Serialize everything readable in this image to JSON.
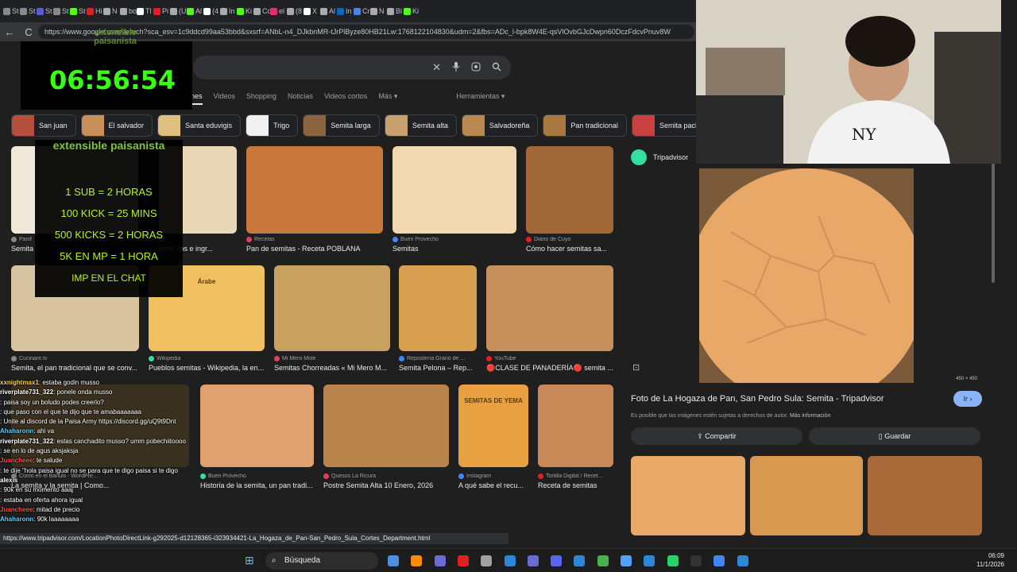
{
  "browser": {
    "tabs": [
      "St",
      "St",
      "St",
      "St",
      "St",
      "Hi",
      "N",
      "bo",
      "Tl",
      "Pi",
      "(U",
      "Al",
      "(4",
      "In",
      "Ki",
      "Cd",
      "el",
      "(8",
      "X",
      "Al",
      "In",
      "Cr",
      "N",
      "Bl",
      "Ki"
    ],
    "url": "https://www.google.com/search?sca_esv=1c9ddcd99aa53bbd&sxsrf=ANbL-n4_DJkbnMR-tJrPlByze80HB21Lw:1768122104830&udm=2&fbs=ADc_l-bpk8W4E-qsVlOvbGJcDwpn60DczFdcvPnuv8W",
    "back": "←",
    "reload": "C"
  },
  "timer": {
    "logo": "extensible paisanista",
    "time": "06:56:54"
  },
  "search": {
    "clear": "✕",
    "mic": "mic",
    "lens": "lens",
    "go": "⌕"
  },
  "filters": [
    "nes",
    "Videos",
    "Shopping",
    "Noticias",
    "Videos cortos",
    "Más ▾",
    "Herramientas ▾"
  ],
  "chips": [
    {
      "label": "San juan",
      "color": "#b4503c"
    },
    {
      "label": "El salvador",
      "color": "#c89058"
    },
    {
      "label": "Santa eduvigis",
      "color": "#e0c080"
    },
    {
      "label": "Trigo",
      "color": "#f0f0f0"
    },
    {
      "label": "Semita larga",
      "color": "#8c6440"
    },
    {
      "label": "Semita alta",
      "color": "#c8a070"
    },
    {
      "label": "Salvadoreña",
      "color": "#b88850"
    },
    {
      "label": "Pan tradicional",
      "color": "#a87840"
    },
    {
      "label": "Semita pacha",
      "color": "#c84040"
    }
  ],
  "results": {
    "row1": [
      {
        "src": "Panif",
        "cap": "Semita",
        "color": "#f0e8d8"
      },
      {
        "src": "",
        "cap": "ecta: tips e ingr...",
        "color": "#e8d8b8"
      },
      {
        "src": "Recetas",
        "cap": "Pan de semitas - Receta POBLANA",
        "color": "#c8783a"
      },
      {
        "src": "Buen Provecho",
        "cap": "Semitas",
        "color": "#f0d8b0"
      },
      {
        "src": "Diario de Cuyo",
        "cap": "Cómo hacer semitas sa...",
        "color": "#a06838"
      }
    ],
    "row2": [
      {
        "src": "Cucinare.tv",
        "cap": "Semita, el pan tradicional que se conv...",
        "color": "#d8c4a0"
      },
      {
        "src": "Wikipedia",
        "cap": "Pueblos semitas - Wikipedia, la en...",
        "color": "#f0c060",
        "extra": "Árabe"
      },
      {
        "src": "Mi Mero Mole",
        "cap": "Semitas Chorreadas « Mi Mero M...",
        "color": "#c8a060"
      },
      {
        "src": "Repostería Grano de ...",
        "cap": "Semita Pelona – Rep...",
        "color": "#d8a050"
      },
      {
        "src": "YouTube",
        "cap": "🔴CLASE DE PANADERÍA🔴 semita ...",
        "color": "#c8905c"
      }
    ],
    "row3": [
      {
        "src": "Como en el Bañuls - WordPre...",
        "cap": "La semita y la semita | Como...",
        "color": "#3a3020"
      },
      {
        "src": "Buen Provecho",
        "cap": "Historia de la semita, un pan tradi...",
        "color": "#e0a070"
      },
      {
        "src": "Quesos La Ricura",
        "cap": "Postre Semita Alta 10 Enero, 2026",
        "color": "#b8844c"
      },
      {
        "src": "Instagram",
        "cap": "A qué sabe el recu...",
        "color": "#e8a040",
        "extra": "SEMITAS DE YEMA"
      },
      {
        "src": "Tortilla Digital / Recet...",
        "cap": "Receta de semitas",
        "color": "#c88858"
      }
    ]
  },
  "overlay": {
    "logo": "extensible paisanista",
    "rules": [
      "1 SUB = 2 HORAS",
      "100 KICK = 25 MINS",
      "500 KICKS = 2 HORAS",
      "5K EN MP = 1 HORA",
      "IMP EN EL CHAT"
    ]
  },
  "panel": {
    "source": "Tripadvisor",
    "dims": "450 × 450",
    "title": "Foto de La Hogaza de Pan, San Pedro Sula: Semita - Tripadvisor",
    "visit": "Ir ›",
    "note": "Es posible que las imágenes estén sujetas a derechos de autor.",
    "note_link": "Más información",
    "share": "Compartir",
    "save": "Guardar",
    "colors": {
      "bread": "#e8a868",
      "accent": "#8ab4f8"
    }
  },
  "chat": [
    {
      "user": "xxnightmax1",
      "msg": "estaba godin musso",
      "color": "#ffd24a"
    },
    {
      "user": "riverplate731_322",
      "msg": "ponele onda musso",
      "color": "#ffffff"
    },
    {
      "user": "",
      "msg": "paisa soy un boludo podes creerlo?",
      "color": "#ff4a4a"
    },
    {
      "user": "",
      "msg": "que paso con el que te dijo que te amabaaaaaaa",
      "color": "#ff4a4a"
    },
    {
      "user": "",
      "msg": "Unite al discord de la Paisa Army https://discord.gg/uQ9t9Dnt",
      "color": "#ff4a4a"
    },
    {
      "user": "Ahaharonn",
      "msg": "ahi va",
      "color": "#5ad0ff"
    },
    {
      "user": "riverplate731_322",
      "msg": "estas canchadito musso? umm pobechiitoooo",
      "color": "#ffffff"
    },
    {
      "user": "",
      "msg": "se en lo de agus aksjaksja",
      "color": "#ff4a4a"
    },
    {
      "user": "Juancheee",
      "msg": "te salude",
      "color": "#ff4a4a"
    },
    {
      "user": "",
      "msg": "te dije \"hola paisa igual no se para que te digo paisa si te digo",
      "color": "#ff4a4a"
    },
    {
      "user": "alexis",
      "msg": "",
      "color": "#ffffff"
    },
    {
      "user": "",
      "msg": "90k en su momento aaaj",
      "color": "#ff4a4a"
    },
    {
      "user": "",
      "msg": "estaba en oferta ahora igual",
      "color": "#ff4a4a"
    },
    {
      "user": "Juancheee",
      "msg": "mitad de precio",
      "color": "#ff4a4a"
    },
    {
      "user": "Ahaharonn",
      "msg": "90k laaaaaaaa",
      "color": "#5ad0ff"
    }
  ],
  "status_url": "https://www.tripadvisor.com/LocationPhotoDirectLink-g292025-d12128365-i323934421-La_Hogaza_de_Pan-San_Pedro_Sula_Cortes_Department.html",
  "taskbar": {
    "search": "Búsqueda",
    "time": "06:09",
    "date": "11/1/2026"
  }
}
